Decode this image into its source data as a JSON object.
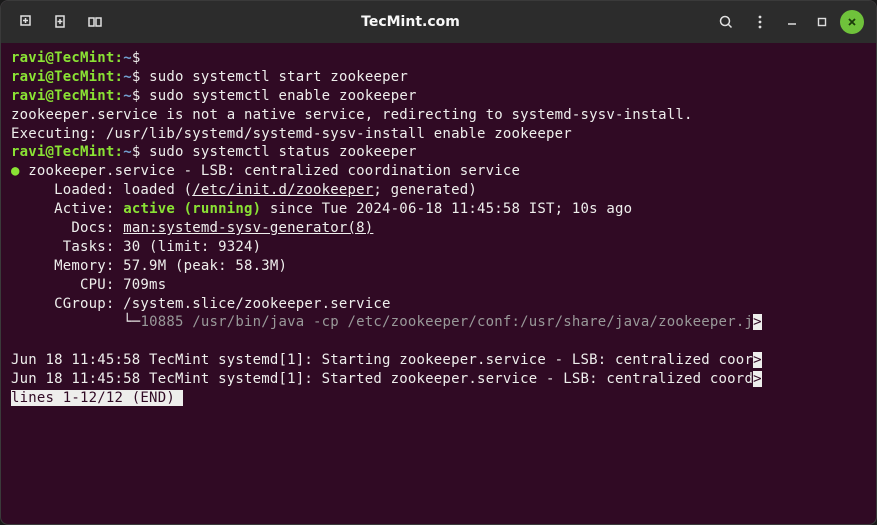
{
  "window": {
    "title": "TecMint.com"
  },
  "prompt": {
    "user": "ravi@TecMint",
    "path": "~",
    "sep": ":",
    "dollar": "$"
  },
  "commands": {
    "c1": "",
    "c2": "sudo systemctl start zookeeper",
    "c3": "sudo systemctl enable zookeeper",
    "c4": "sudo systemctl status zookeeper"
  },
  "output": {
    "redirect": "zookeeper.service is not a native service, redirecting to systemd-sysv-install.",
    "executing": "Executing: /usr/lib/systemd/systemd-sysv-install enable zookeeper",
    "header": "zookeeper.service - LSB: centralized coordination service",
    "loaded_label": "     Loaded: loaded (",
    "loaded_path": "/etc/init.d/zookeeper",
    "loaded_tail": "; generated)",
    "active_label": "     Active: ",
    "active_value": "active (running)",
    "active_tail": " since Tue 2024-06-18 11:45:58 IST; 10s ago",
    "docs_label": "       Docs: ",
    "docs_value": "man:systemd-sysv-generator(8)",
    "tasks": "      Tasks: 30 (limit: 9324)",
    "memory": "     Memory: 57.9M (peak: 58.3M)",
    "cpu": "        CPU: 709ms",
    "cgroup": "     CGroup: /system.slice/zookeeper.service",
    "tree": "             └─",
    "proc": "10885 /usr/bin/java -cp /etc/zookeeper/conf:/usr/share/java/zookeeper.j",
    "log1": "Jun 18 11:45:58 TecMint systemd[1]: Starting zookeeper.service - LSB: centralized coor",
    "log2": "Jun 18 11:45:58 TecMint systemd[1]: Started zookeeper.service - LSB: centralized coord",
    "pager": "lines 1-12/12 (END)",
    "scroll": ">"
  }
}
